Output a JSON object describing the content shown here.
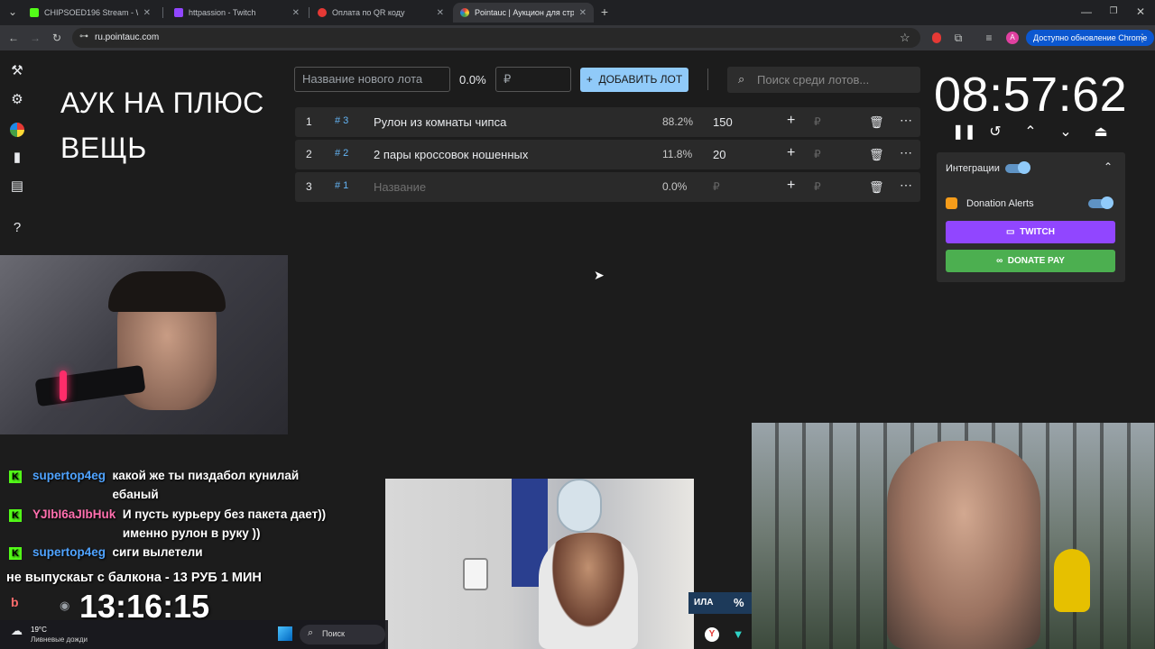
{
  "browser": {
    "tabs": [
      {
        "title": "CHIPSOED196 Stream - Watch Li",
        "favicon_color": "#53fc18",
        "active": false
      },
      {
        "title": "httpassion - Twitch",
        "favicon_color": "#9146ff",
        "active": false
      },
      {
        "title": "Оплата по QR коду",
        "favicon_color": "#e53935",
        "active": false
      },
      {
        "title": "Pointauc | Аукцион для стрим",
        "favicon_color": "#ffb300",
        "active": true
      }
    ],
    "url": "ru.pointauc.com",
    "avatar_letter": "A",
    "update_label": "Доступно обновление Chrome"
  },
  "auction": {
    "title": "АУК НА ПЛЮС ВЕЩЬ",
    "new_lot_placeholder": "Название нового лота",
    "new_lot_percent": "0.0%",
    "currency": "₽",
    "add_button": "ДОБАВИТЬ ЛОТ",
    "search_placeholder": "Поиск среди лотов...",
    "lots": [
      {
        "index": "1",
        "hash": "# 3",
        "name": "Рулон из комнаты чипса",
        "percent": "88.2%",
        "amount": "150"
      },
      {
        "index": "2",
        "hash": "# 2",
        "name": "2 пары кроссовок ношенных",
        "percent": "11.8%",
        "amount": "20"
      },
      {
        "index": "3",
        "hash": "# 1",
        "name": "Название",
        "percent": "0.0%",
        "amount": "₽"
      }
    ],
    "timer": "08:57:62",
    "integrations": {
      "header": "Интеграции",
      "donation_alerts": "Donation Alerts",
      "twitch_button": "TWITCH",
      "donatepay_button": "DONATE PAY"
    }
  },
  "stream_overlay": {
    "chat": [
      {
        "user": "supertop4eg",
        "user_color": "#4fa3ff",
        "message": "какой же ты пиздабол кунилай ебаный"
      },
      {
        "user": "YJIbI6aJIbHuk",
        "user_color": "#ff6fae",
        "message": "И пусть курьеру без пакета дает)) именно рулон в руку ))"
      },
      {
        "user": "supertop4eg",
        "user_color": "#4fa3ff",
        "message": "сиги вылетели"
      }
    ],
    "ticker": "не выпускаьт с балкона - 13 РУБ 1 МИН",
    "stream_timer": "13:16:15",
    "donation_tail": "ИЛА",
    "percent_sign": "%"
  },
  "taskbar": {
    "weather_temp": "19°C",
    "weather_text": "Ливневые дожди",
    "search_label": "Поиск"
  }
}
